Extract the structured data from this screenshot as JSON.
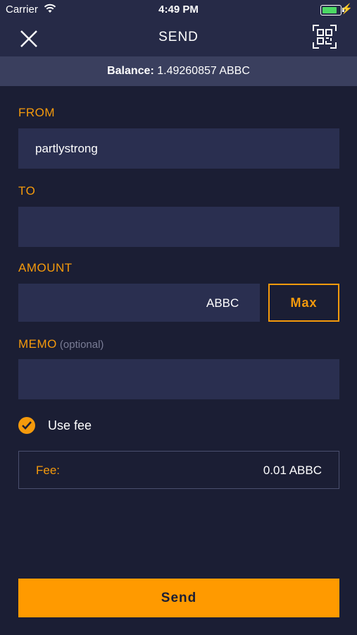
{
  "status_bar": {
    "carrier": "Carrier",
    "time": "4:49 PM"
  },
  "nav": {
    "title": "SEND",
    "close_icon": "close-icon",
    "qr_icon": "qr-scan-icon"
  },
  "balance": {
    "label": "Balance:",
    "value": "1.49260857 ABBC"
  },
  "form": {
    "from_label": "FROM",
    "from_value": "partlystrong",
    "to_label": "TO",
    "to_value": "",
    "amount_label": "AMOUNT",
    "amount_value": "",
    "amount_unit": "ABBC",
    "max_label": "Max",
    "memo_label": "MEMO",
    "memo_hint": "(optional)",
    "memo_value": "",
    "use_fee_label": "Use fee",
    "use_fee_checked": true,
    "fee_label": "Fee:",
    "fee_value": "0.01 ABBC"
  },
  "send_label": "Send",
  "colors": {
    "accent": "#f59a0c",
    "background": "#1b1e34",
    "field": "#2a2f50",
    "bar": "#262a47"
  }
}
